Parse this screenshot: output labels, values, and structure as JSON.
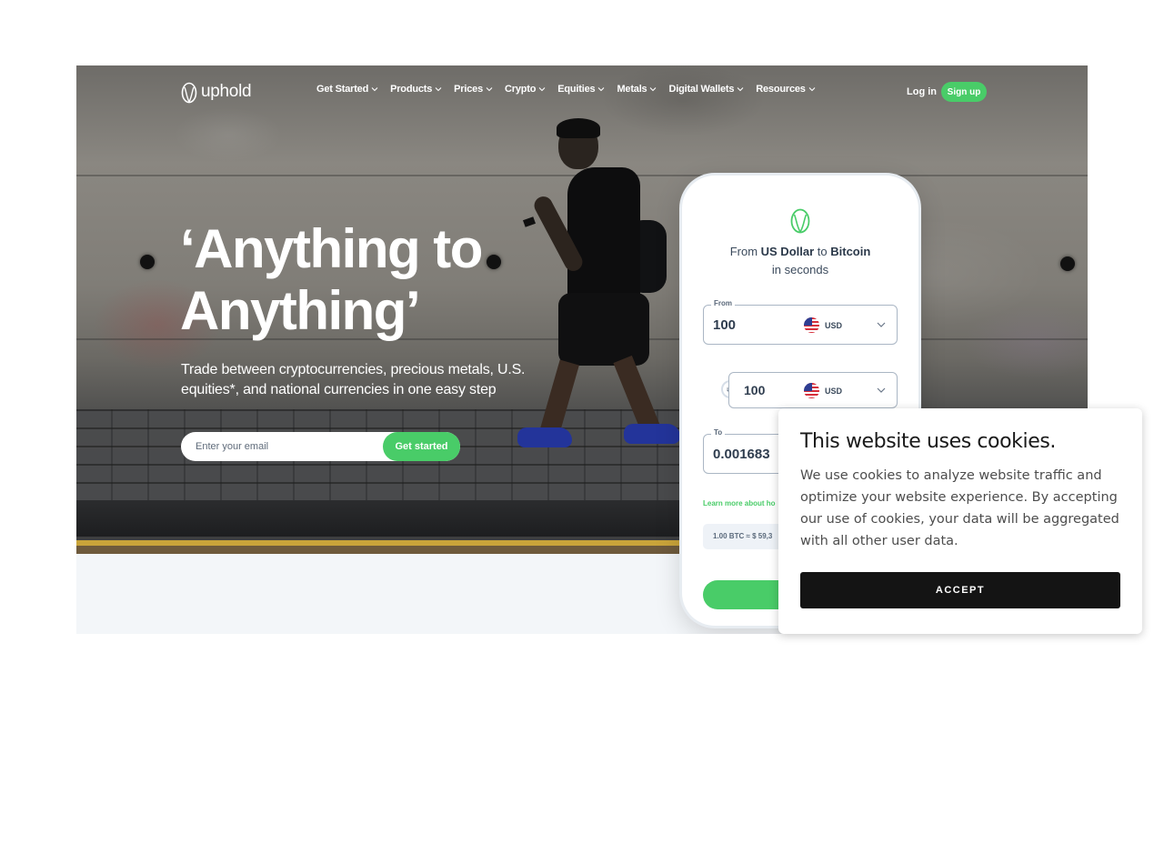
{
  "nav": {
    "logo_text": "uphold",
    "menu": [
      {
        "label": "Get Started"
      },
      {
        "label": "Products"
      },
      {
        "label": "Prices"
      },
      {
        "label": "Crypto"
      },
      {
        "label": "Equities"
      },
      {
        "label": "Metals"
      },
      {
        "label": "Digital Wallets"
      },
      {
        "label": "Resources"
      }
    ],
    "login": "Log in",
    "signup": "Sign up"
  },
  "hero": {
    "headline_line1": "‘Anything to",
    "headline_line2": "Anything’",
    "subhead_line1": "Trade between cryptocurrencies, precious metals, U.S.",
    "subhead_line2": "equities*, and national currencies in one easy step",
    "email_placeholder": "Enter your email",
    "cta": "Get started"
  },
  "converter": {
    "title_prefix": "From ",
    "title_from": "US Dollar",
    "title_mid": " to ",
    "title_to": "Bitcoin",
    "title_line2": "in seconds",
    "from_label": "From",
    "from_value": "100",
    "from_currency": "USD",
    "mid_value": "100",
    "mid_currency": "USD",
    "swap_symbol": "⇌",
    "to_label": "To",
    "to_value": "0.001683",
    "learn_more": "Learn more about ho",
    "rate": "1.00 BTC ≈ $ 59,3"
  },
  "cookie": {
    "title": "This website uses cookies.",
    "body": "We use cookies to analyze website traffic and optimize your website experience. By accepting our use of cookies, your data will be aggregated with all other user data.",
    "accept": "ACCEPT"
  },
  "colors": {
    "brand_green": "#49cc68",
    "dark_button": "#141414"
  }
}
